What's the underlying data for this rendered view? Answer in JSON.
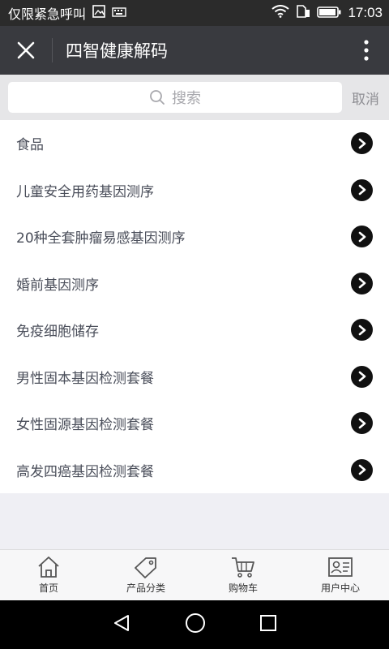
{
  "status_bar": {
    "carrier_text": "仅限紧急呼叫",
    "time": "17:03"
  },
  "header": {
    "title": "四智健康解码"
  },
  "search": {
    "placeholder": "搜索",
    "cancel_label": "取消"
  },
  "list": {
    "items": [
      {
        "label": "食品"
      },
      {
        "label": "儿童安全用药基因测序"
      },
      {
        "label": "20种全套肿瘤易感基因测序"
      },
      {
        "label": "婚前基因测序"
      },
      {
        "label": "免疫细胞储存"
      },
      {
        "label": "男性固本基因检测套餐"
      },
      {
        "label": "女性固源基因检测套餐"
      },
      {
        "label": "高发四癌基因检测套餐"
      }
    ]
  },
  "tab_bar": {
    "tabs": [
      {
        "label": "首页",
        "icon": "home-icon"
      },
      {
        "label": "产品分类",
        "icon": "tag-icon"
      },
      {
        "label": "购物车",
        "icon": "cart-icon"
      },
      {
        "label": "用户中心",
        "icon": "user-card-icon"
      }
    ]
  },
  "colors": {
    "title_bar": "#393a3f",
    "status_bar": "#2b2b2b",
    "arrow": "#111111"
  }
}
